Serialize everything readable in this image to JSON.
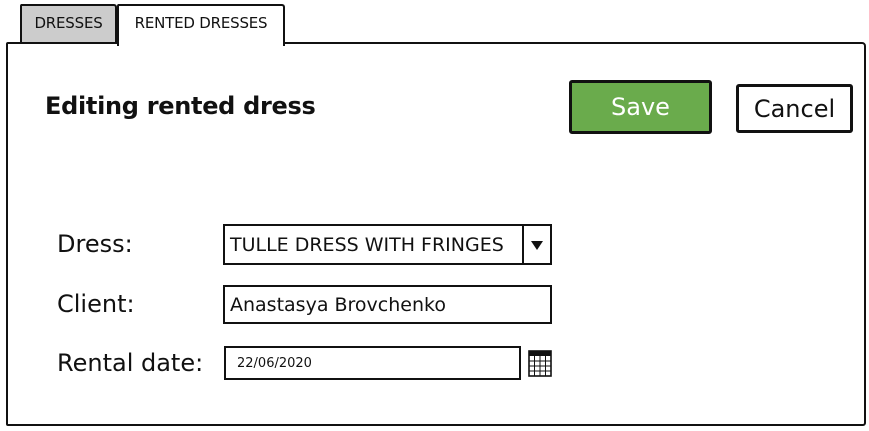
{
  "tabs": [
    {
      "label": "DRESSES",
      "active": false
    },
    {
      "label": "RENTED DRESSES",
      "active": true
    }
  ],
  "form": {
    "title": "Editing rented dress",
    "save_label": "Save",
    "cancel_label": "Cancel",
    "dress_label": "Dress:",
    "dress_value": "TULLE DRESS WITH FRINGES",
    "client_label": "Client:",
    "client_value": "Anastasya Brovchenko",
    "date_label": "Rental date:",
    "date_value": "22/06/2020"
  },
  "icons": {
    "dropdown": "chevron-down-icon",
    "calendar": "calendar-icon"
  },
  "colors": {
    "save_button": "#6aab4c",
    "inactive_tab": "#cccccc"
  }
}
